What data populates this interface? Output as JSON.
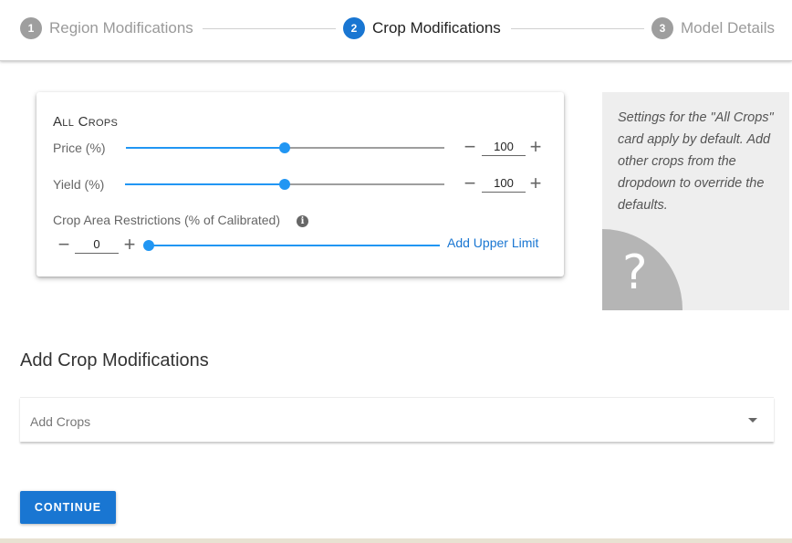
{
  "stepper": {
    "steps": [
      {
        "number": "1",
        "label": "Region Modifications",
        "state": "inactive"
      },
      {
        "number": "2",
        "label": "Crop Modifications",
        "state": "active"
      },
      {
        "number": "3",
        "label": "Model Details",
        "state": "inactive"
      }
    ]
  },
  "all_crops": {
    "title": "All Crops",
    "price": {
      "label": "Price (%)",
      "value": "100",
      "slider_fraction": 0.5
    },
    "yield": {
      "label": "Yield (%)",
      "value": "100",
      "slider_fraction": 0.5
    },
    "area": {
      "label": "Crop Area Restrictions (% of Calibrated)",
      "value": "0",
      "info_glyph": "i",
      "add_upper_limit": "Add Upper Limit",
      "slider_fraction": 0.0
    }
  },
  "help": {
    "text": "Settings for the \"All Crops\" card apply by default. Add other crops from the dropdown to override the defaults.",
    "icon_glyph": "?"
  },
  "add_crops": {
    "title": "Add Crop Modifications",
    "placeholder": "Add Crops"
  },
  "continue_label": "CONTINUE",
  "glyphs": {
    "minus": "−",
    "plus": "+"
  },
  "colors": {
    "primary": "#1976d2",
    "slider": "#2196f3",
    "inactive_step": "#9e9e9e"
  }
}
